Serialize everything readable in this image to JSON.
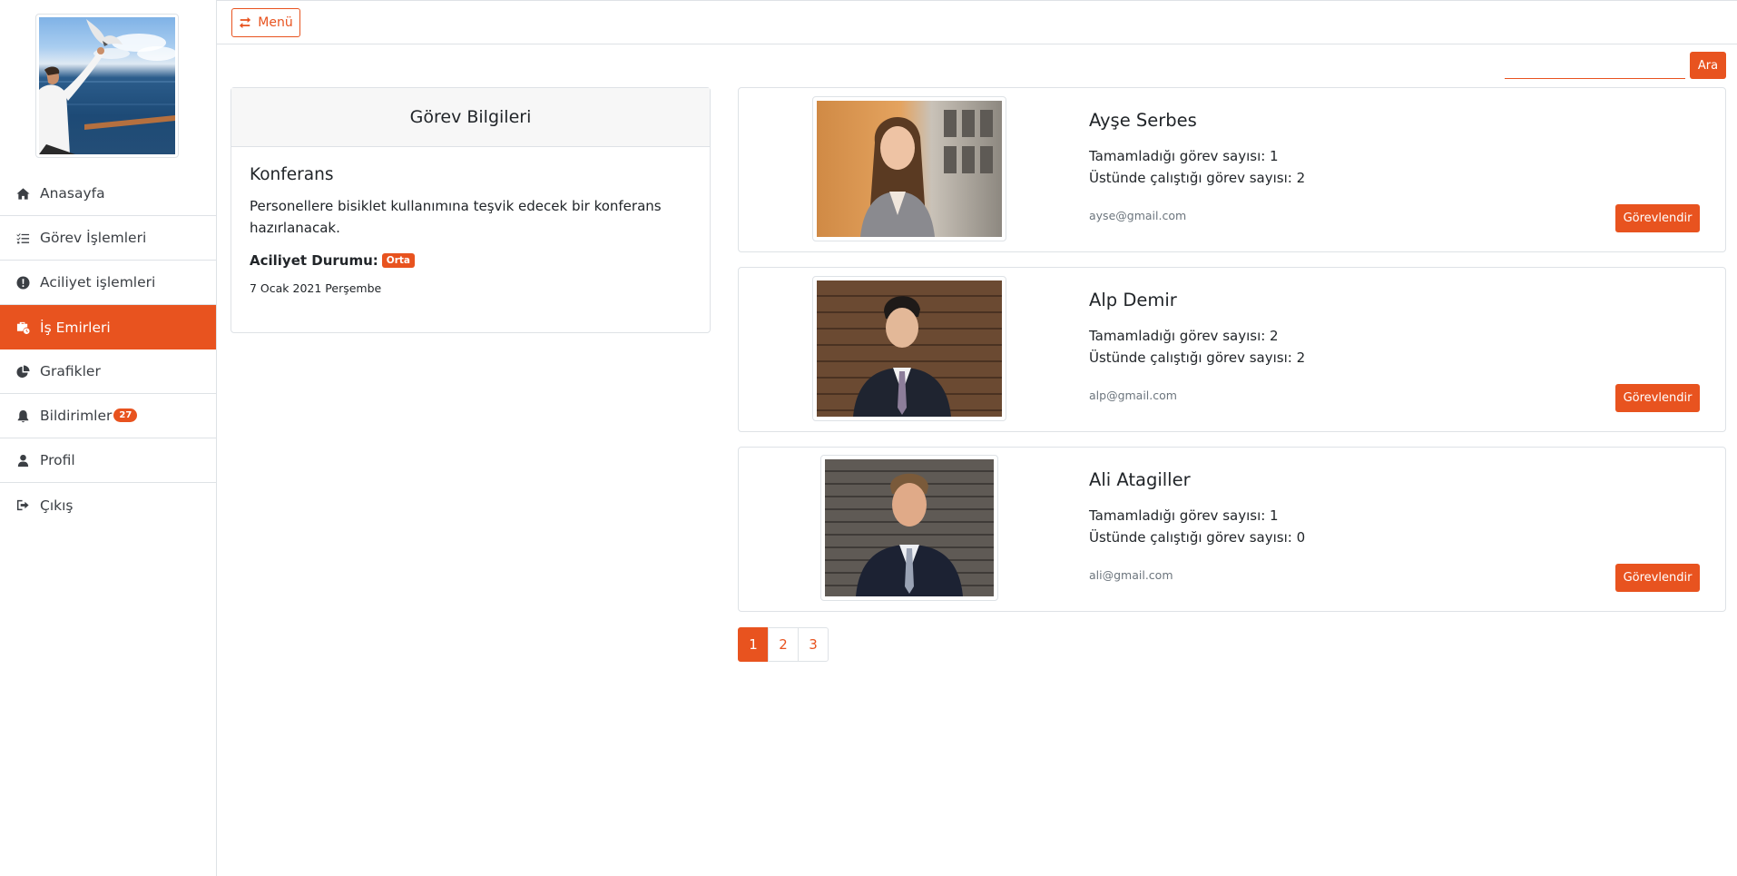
{
  "topbar": {
    "menu_label": "Menü"
  },
  "search": {
    "placeholder": "",
    "value": "",
    "button_label": "Ara"
  },
  "sidebar": {
    "items": [
      {
        "label": "Anasayfa",
        "icon": "home-icon"
      },
      {
        "label": "Görev İşlemleri",
        "icon": "list-check-icon"
      },
      {
        "label": "Aciliyet işlemleri",
        "icon": "exclamation-circle-icon"
      },
      {
        "label": "İş Emirleri",
        "icon": "briefcase-clock-icon",
        "active": true
      },
      {
        "label": "Grafikler",
        "icon": "pie-chart-icon"
      },
      {
        "label": "Bildirimler",
        "icon": "bell-icon",
        "badge": "27"
      },
      {
        "label": "Profil",
        "icon": "user-icon"
      },
      {
        "label": "Çıkış",
        "icon": "sign-out-icon"
      }
    ]
  },
  "task": {
    "header": "Görev Bilgileri",
    "title": "Konferans",
    "description": "Personellere bisiklet kullanımına teşvik edecek bir konferans hazırlanacak.",
    "urgency_label": "Aciliyet Durumu:",
    "urgency_value": "Orta",
    "date": "7 Ocak 2021 Perşembe"
  },
  "employees": [
    {
      "name": "Ayşe Serbes",
      "completed": "Tamamladığı görev sayısı: 1",
      "working": "Üstünde çalıştığı görev sayısı: 2",
      "email": "ayse@gmail.com",
      "button": "Görevlendir"
    },
    {
      "name": "Alp Demir",
      "completed": "Tamamladığı görev sayısı: 2",
      "working": "Üstünde çalıştığı görev sayısı: 2",
      "email": "alp@gmail.com",
      "button": "Görevlendir"
    },
    {
      "name": "Ali Atagiller",
      "completed": "Tamamladığı görev sayısı: 1",
      "working": "Üstünde çalıştığı görev sayısı: 0",
      "email": "ali@gmail.com",
      "button": "Görevlendir"
    }
  ],
  "pagination": {
    "pages": [
      "1",
      "2",
      "3"
    ],
    "current": "1"
  },
  "colors": {
    "accent": "#e8531f",
    "border": "#dee2e6",
    "header_bg": "#f7f7f7"
  }
}
